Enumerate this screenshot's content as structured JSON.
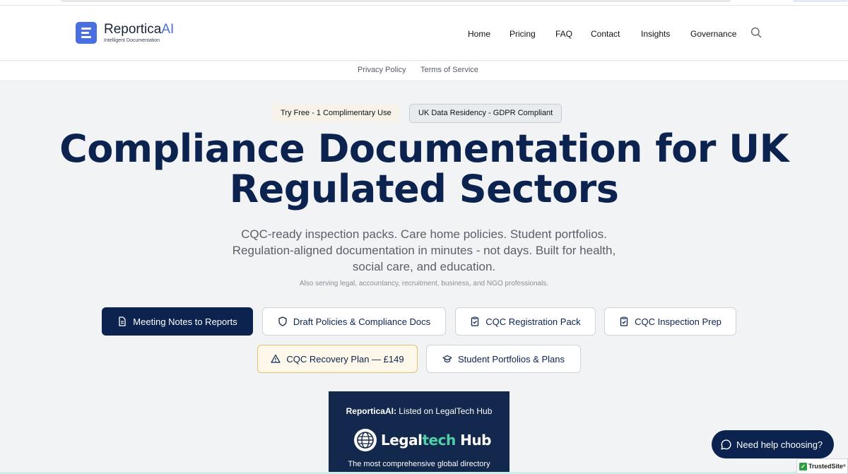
{
  "logo": {
    "name_main": "Reportica",
    "name_accent": "AI",
    "tagline": "Intelligent Documentation"
  },
  "nav": {
    "items": [
      "Home",
      "Pricing",
      "FAQ",
      "Contact",
      "Insights",
      "Governance"
    ]
  },
  "subnav": {
    "privacy": "Privacy Policy",
    "terms": "Terms of Service"
  },
  "badges": {
    "free": "Try Free - 1 Complimentary Use",
    "gdpr": "UK Data Residency - GDPR Compliant"
  },
  "hero": {
    "headline_line1": "Compliance Documentation for UK",
    "headline_line2": "Regulated Sectors",
    "lead_line1": "CQC-ready inspection packs. Care home policies. Student portfolios.",
    "lead_line2": "Regulation-aligned documentation in minutes - not days. Built for health,",
    "lead_line3": "social care, and education.",
    "also": "Also serving legal, accountancy, recruitment, business, and NGO professionals."
  },
  "actions": {
    "meeting_notes": "Meeting Notes to Reports",
    "draft_policies": "Draft Policies & Compliance Docs",
    "cqc_registration": "CQC Registration Pack",
    "cqc_inspection": "CQC Inspection Prep",
    "cqc_recovery": "CQC Recovery Plan — £149",
    "student_portfolios": "Student Portfolios & Plans"
  },
  "legal_card": {
    "brand": "ReporticaAI:",
    "listed": "Listed on LegalTech Hub",
    "hub_legal": "Legal",
    "hub_tech": "tech",
    "hub_hub": " Hub",
    "desc": "The most comprehensive global directory"
  },
  "help": {
    "label": "Need help choosing?"
  },
  "trusted": {
    "label": "TrustedSite",
    "mark": "®"
  },
  "colors": {
    "navy": "#0c2350",
    "accent": "#4a6fe0",
    "warn_border": "#e0c26a",
    "hub_green": "#4fd0a8"
  },
  "icons": [
    "search-icon",
    "document-icon",
    "shield-icon",
    "clipboard-check-icon",
    "warning-triangle-icon",
    "graduation-cap-icon",
    "chat-bubble-icon",
    "globe-icon",
    "check-icon"
  ]
}
